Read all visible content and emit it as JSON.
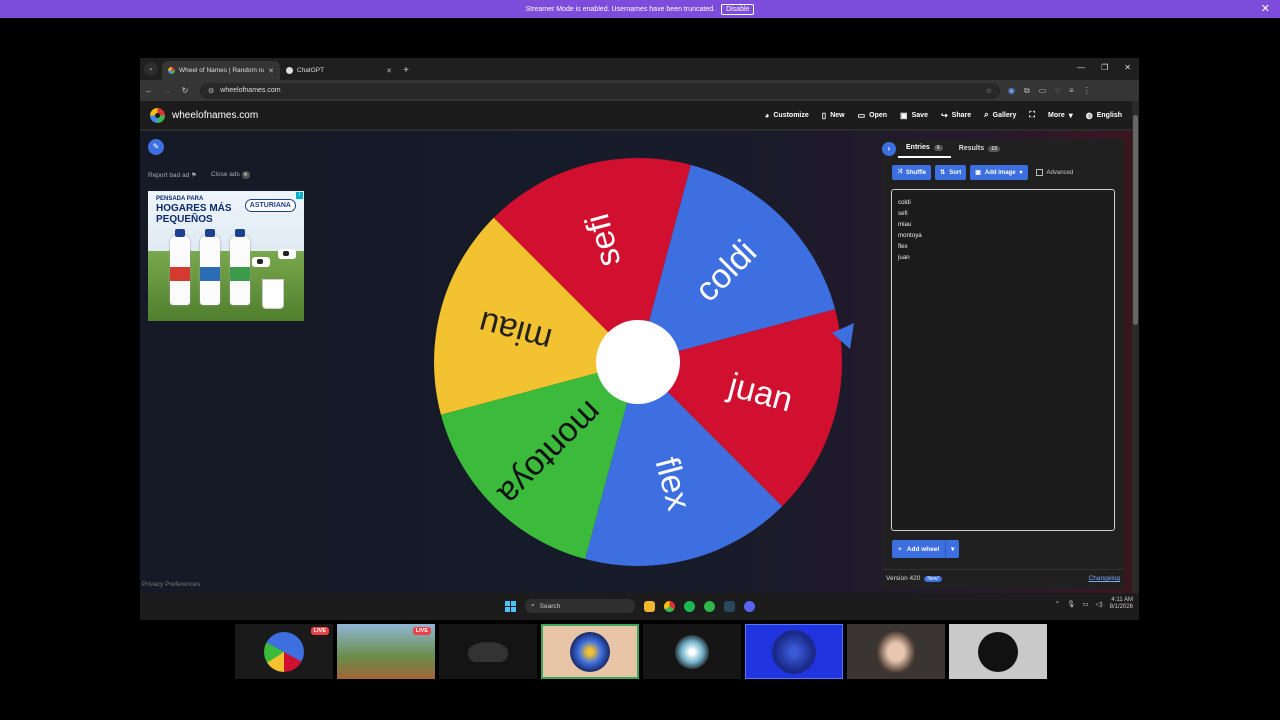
{
  "banner": {
    "text": "Streamer Mode is enabled. Usernames have been truncated.",
    "button": "Disable"
  },
  "browser": {
    "tabs": [
      {
        "title": "Wheel of Names | Random nam",
        "active": true
      },
      {
        "title": "ChatGPT",
        "active": false
      }
    ],
    "url": "wheelofnames.com"
  },
  "site": {
    "logo_text": "wheelofnames.com",
    "menu": [
      "Customize",
      "New",
      "Open",
      "Save",
      "Share",
      "Gallery",
      "More",
      "English"
    ]
  },
  "ad": {
    "report_label": "Report bad ad",
    "close_label": "Close ads",
    "headline_small": "PENSADA PARA",
    "headline_big": "HOGARES MÁS PEQUEÑOS",
    "brand": "ASTURIANA"
  },
  "wheel": {
    "segments": [
      {
        "label": "coldi",
        "color": "#3d6fe0"
      },
      {
        "label": "sefi",
        "color": "#d0102e"
      },
      {
        "label": "miau",
        "color": "#f2c230"
      },
      {
        "label": "montoya",
        "color": "#3cba3c"
      },
      {
        "label": "flex",
        "color": "#3d6fe0"
      },
      {
        "label": "juan",
        "color": "#d0102e"
      }
    ]
  },
  "privacy_label": "Privacy Preferences",
  "sidebar": {
    "tabs": [
      {
        "label": "Entries",
        "count": "6"
      },
      {
        "label": "Results",
        "count": "15"
      }
    ],
    "toolbar": {
      "shuffle": "Shuffle",
      "sort": "Sort",
      "add_image": "Add image",
      "advanced": "Advanced"
    },
    "entries": [
      "coldi",
      "sefi",
      "miau",
      "montoya",
      "flex",
      "juan"
    ],
    "add_wheel": "Add wheel",
    "version": "Version 420",
    "new_badge": "New!",
    "changelog": "Changelog"
  },
  "taskbar": {
    "search": "Search",
    "time": "4:11 AM",
    "date": "8/1/2026"
  },
  "thumbnails": {
    "live_label": "LIVE"
  },
  "colors": {
    "accent": "#3d6fe0",
    "banner": "#7d4cdb"
  }
}
